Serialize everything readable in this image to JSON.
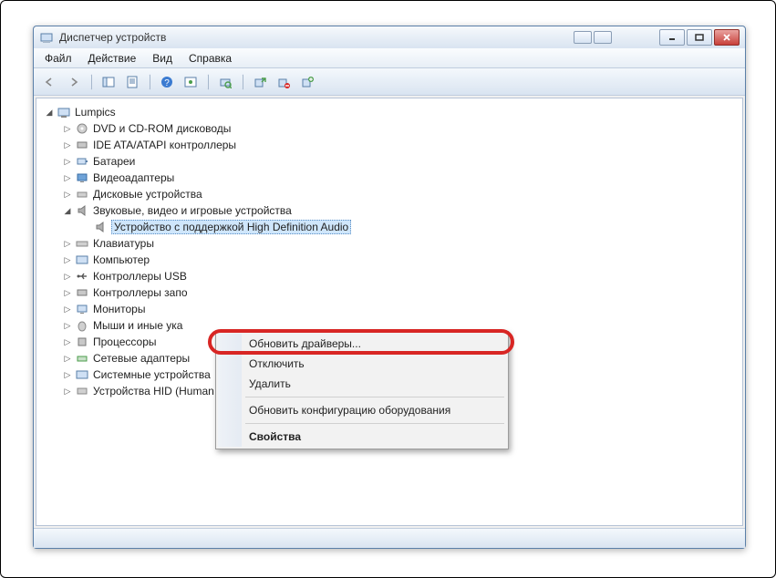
{
  "window": {
    "title": "Диспетчер устройств"
  },
  "menu": {
    "file": "Файл",
    "action": "Действие",
    "view": "Вид",
    "help": "Справка"
  },
  "tree": {
    "root": "Lumpics",
    "items": [
      "DVD и CD-ROM дисководы",
      "IDE ATA/ATAPI контроллеры",
      "Батареи",
      "Видеоадаптеры",
      "Дисковые устройства"
    ],
    "sound_group": "Звуковые, видео и игровые устройства",
    "selected_device": "Устройство с поддержкой High Definition Audio",
    "items2": [
      "Клавиатуры",
      "Компьютер",
      "Контроллеры USB",
      "Контроллеры запо",
      "Мониторы",
      "Мыши и иные ука",
      "Процессоры",
      "Сетевые адаптеры",
      "Системные устройства",
      "Устройства HID (Human Interface Devices)"
    ]
  },
  "context": {
    "update": "Обновить драйверы...",
    "disable": "Отключить",
    "delete": "Удалить",
    "rescan": "Обновить конфигурацию оборудования",
    "props": "Свойства"
  }
}
